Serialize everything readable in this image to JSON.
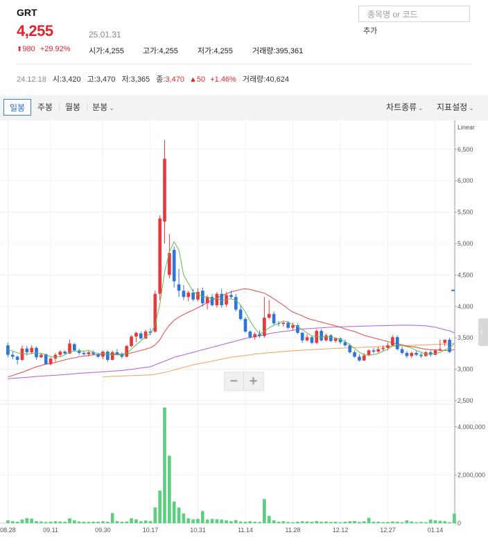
{
  "stock": {
    "name": "GRT",
    "price": "4,255",
    "date": "25.01.31",
    "change_amount": "980",
    "change_percent": "+29.92%",
    "open_label": "시가",
    "open": "4,255",
    "high_label": "고가",
    "high": "4,255",
    "low_label": "저가",
    "low": "4,255",
    "volume_label": "거래량",
    "volume": "395,361"
  },
  "search": {
    "placeholder": "종목명 or 코드",
    "add_label": "추가"
  },
  "hover": {
    "date": "24.12.18",
    "open_label": "시",
    "open": "3,420",
    "high_label": "고",
    "high": "3,470",
    "low_label": "저",
    "low": "3,365",
    "close_label": "종",
    "close": "3,470",
    "change": "50",
    "change_percent": "+1.46%",
    "volume_label": "거래량",
    "volume": "40,624"
  },
  "toolbar": {
    "tabs": [
      "일봉",
      "주봉",
      "월봉",
      "분봉"
    ],
    "active_tab": "일봉",
    "chart_type_label": "차트종류",
    "indicator_label": "지표설정"
  },
  "colors": {
    "up": "#e8383d",
    "down": "#2f74d8",
    "ma5": "#5cbf4e",
    "ma20": "#e04848",
    "ma60": "#b35ae0",
    "ma120": "#f0a05a",
    "volume": "#5ccf7e"
  },
  "chart_data": {
    "type": "candlestick",
    "scale_label": "Linear",
    "price_axis": {
      "ticks": [
        "6,500",
        "6,000",
        "5,500",
        "5,000",
        "4,500",
        "4,000",
        "3,500",
        "3,000",
        "2,500"
      ],
      "range": [
        2500,
        6850
      ]
    },
    "volume_axis": {
      "ticks": [
        "4,000,000",
        "2,000,000",
        "0"
      ],
      "range": [
        0,
        4800000
      ]
    },
    "x_labels": [
      "08.28",
      "09.11",
      "09.30",
      "10.17",
      "10.31",
      "11.14",
      "11.28",
      "12.12",
      "12.27",
      "01.14"
    ],
    "x_label_index": [
      0,
      9,
      20,
      30,
      40,
      50,
      60,
      70,
      80,
      90
    ],
    "last_price": 4255,
    "candles": [
      [
        3380,
        3420,
        3190,
        3230
      ],
      [
        3230,
        3280,
        3160,
        3200
      ],
      [
        3200,
        3220,
        3080,
        3150
      ],
      [
        3150,
        3380,
        3130,
        3330
      ],
      [
        3330,
        3370,
        3220,
        3270
      ],
      [
        3270,
        3380,
        3240,
        3340
      ],
      [
        3340,
        3360,
        3150,
        3190
      ],
      [
        3190,
        3260,
        3180,
        3230
      ],
      [
        3240,
        3250,
        3070,
        3080
      ],
      [
        3080,
        3190,
        3060,
        3170
      ],
      [
        3170,
        3260,
        3120,
        3230
      ],
      [
        3230,
        3300,
        3200,
        3280
      ],
      [
        3280,
        3300,
        3230,
        3250
      ],
      [
        3250,
        3470,
        3240,
        3410
      ],
      [
        3400,
        3420,
        3280,
        3300
      ],
      [
        3300,
        3330,
        3230,
        3260
      ],
      [
        3260,
        3290,
        3220,
        3240
      ],
      [
        3240,
        3290,
        3200,
        3270
      ],
      [
        3270,
        3300,
        3220,
        3240
      ],
      [
        3240,
        3260,
        3180,
        3200
      ],
      [
        3200,
        3300,
        3160,
        3280
      ],
      [
        3280,
        3300,
        3120,
        3150
      ],
      [
        3150,
        3300,
        3140,
        3270
      ],
      [
        3270,
        3320,
        3220,
        3240
      ],
      [
        3240,
        3270,
        3170,
        3200
      ],
      [
        3200,
        3390,
        3190,
        3370
      ],
      [
        3370,
        3540,
        3350,
        3520
      ],
      [
        3520,
        3600,
        3430,
        3580
      ],
      [
        3570,
        3600,
        3470,
        3490
      ],
      [
        3490,
        3630,
        3480,
        3600
      ],
      [
        3600,
        3650,
        3540,
        3580
      ],
      [
        3600,
        4250,
        3580,
        4200
      ],
      [
        4200,
        5450,
        4100,
        5400
      ],
      [
        5350,
        6650,
        5000,
        6350
      ],
      [
        4500,
        5150,
        4450,
        4850
      ],
      [
        4900,
        4950,
        4300,
        4400
      ],
      [
        4350,
        4600,
        4150,
        4250
      ],
      [
        4250,
        4340,
        4100,
        4150
      ],
      [
        4150,
        4250,
        4080,
        4220
      ],
      [
        4220,
        4280,
        4080,
        4110
      ],
      [
        4110,
        4290,
        4080,
        4230
      ],
      [
        4250,
        4300,
        4000,
        4050
      ],
      [
        4050,
        4180,
        3950,
        4150
      ],
      [
        4150,
        4200,
        4000,
        4020
      ],
      [
        4020,
        4230,
        3980,
        4200
      ],
      [
        4200,
        4280,
        3980,
        4020
      ],
      [
        4030,
        4230,
        3990,
        4180
      ],
      [
        4180,
        4250,
        4120,
        4150
      ],
      [
        4150,
        4200,
        3920,
        3950
      ],
      [
        3950,
        4020,
        3780,
        3800
      ],
      [
        3800,
        3830,
        3580,
        3600
      ],
      [
        3600,
        3620,
        3490,
        3510
      ],
      [
        3510,
        3590,
        3470,
        3560
      ],
      [
        3560,
        3620,
        3500,
        3530
      ],
      [
        3530,
        4150,
        3500,
        3820
      ],
      [
        3820,
        4100,
        3800,
        3880
      ],
      [
        3880,
        3920,
        3700,
        3730
      ],
      [
        3730,
        3770,
        3680,
        3720
      ],
      [
        3720,
        3760,
        3680,
        3740
      ],
      [
        3740,
        3770,
        3640,
        3660
      ],
      [
        3660,
        3740,
        3620,
        3700
      ],
      [
        3700,
        3730,
        3560,
        3580
      ],
      [
        3580,
        3600,
        3420,
        3460
      ],
      [
        3460,
        3560,
        3440,
        3510
      ],
      [
        3510,
        3530,
        3400,
        3420
      ],
      [
        3420,
        3640,
        3400,
        3610
      ],
      [
        3610,
        3640,
        3440,
        3460
      ],
      [
        3460,
        3570,
        3440,
        3540
      ],
      [
        3540,
        3560,
        3430,
        3450
      ],
      [
        3450,
        3510,
        3420,
        3490
      ],
      [
        3490,
        3510,
        3400,
        3430
      ],
      [
        3430,
        3470,
        3360,
        3380
      ],
      [
        3380,
        3410,
        3250,
        3270
      ],
      [
        3270,
        3300,
        3180,
        3200
      ],
      [
        3200,
        3240,
        3120,
        3140
      ],
      [
        3140,
        3260,
        3130,
        3220
      ],
      [
        3220,
        3320,
        3210,
        3300
      ],
      [
        3300,
        3340,
        3250,
        3280
      ],
      [
        3280,
        3360,
        3260,
        3320
      ],
      [
        3320,
        3380,
        3280,
        3340
      ],
      [
        3340,
        3420,
        3300,
        3380
      ],
      [
        3380,
        3540,
        3360,
        3510
      ],
      [
        3510,
        3540,
        3300,
        3320
      ],
      [
        3320,
        3360,
        3230,
        3260
      ],
      [
        3260,
        3290,
        3180,
        3210
      ],
      [
        3210,
        3280,
        3180,
        3260
      ],
      [
        3260,
        3290,
        3210,
        3230
      ],
      [
        3230,
        3260,
        3180,
        3210
      ],
      [
        3210,
        3290,
        3200,
        3270
      ],
      [
        3270,
        3300,
        3200,
        3230
      ],
      [
        3230,
        3320,
        3220,
        3300
      ],
      [
        3300,
        3470,
        3290,
        3320
      ],
      [
        3420,
        3470,
        3365,
        3470
      ],
      [
        3470,
        3500,
        3260,
        3275
      ]
    ],
    "ma5": [
      3310,
      3290,
      3260,
      3250,
      3240,
      3250,
      3260,
      3250,
      3230,
      3200,
      3190,
      3200,
      3230,
      3270,
      3290,
      3290,
      3290,
      3300,
      3270,
      3250,
      3250,
      3240,
      3230,
      3230,
      3230,
      3250,
      3320,
      3390,
      3450,
      3520,
      3570,
      3700,
      4040,
      4550,
      4870,
      5030,
      4900,
      4500,
      4370,
      4230,
      4190,
      4160,
      4150,
      4120,
      4130,
      4090,
      4110,
      4120,
      4100,
      4020,
      3910,
      3770,
      3650,
      3560,
      3600,
      3660,
      3700,
      3730,
      3770,
      3750,
      3710,
      3680,
      3630,
      3580,
      3530,
      3520,
      3510,
      3520,
      3510,
      3500,
      3470,
      3440,
      3390,
      3330,
      3270,
      3230,
      3230,
      3230,
      3250,
      3290,
      3320,
      3370,
      3390,
      3380,
      3360,
      3340,
      3300,
      3270,
      3240,
      3240,
      3250,
      3270,
      3310,
      3340,
      3410
    ],
    "ma20": [
      2880,
      2900,
      2930,
      2950,
      2980,
      3010,
      3040,
      3060,
      3080,
      3090,
      3110,
      3130,
      3150,
      3170,
      3180,
      3200,
      3210,
      3220,
      3230,
      3230,
      3240,
      3240,
      3240,
      3240,
      3240,
      3250,
      3260,
      3280,
      3300,
      3320,
      3340,
      3390,
      3470,
      3600,
      3700,
      3780,
      3830,
      3870,
      3910,
      3940,
      3980,
      4020,
      4060,
      4100,
      4140,
      4170,
      4200,
      4230,
      4250,
      4270,
      4280,
      4270,
      4250,
      4230,
      4210,
      4170,
      4120,
      4070,
      4020,
      3960,
      3910,
      3880,
      3850,
      3810,
      3790,
      3770,
      3750,
      3730,
      3710,
      3690,
      3670,
      3640,
      3620,
      3600,
      3570,
      3540,
      3520,
      3500,
      3480,
      3460,
      3440,
      3420,
      3400,
      3390,
      3370,
      3360,
      3350,
      3330,
      3320,
      3310,
      3310,
      3300,
      3300,
      3300,
      3310
    ],
    "ma60": [
      2850,
      2855,
      2860,
      2865,
      2870,
      2880,
      2885,
      2890,
      2895,
      2900,
      2905,
      2910,
      2915,
      2920,
      2930,
      2935,
      2940,
      2945,
      2950,
      2955,
      2960,
      2965,
      2970,
      2975,
      2980,
      2990,
      3000,
      3010,
      3020,
      3030,
      3040,
      3070,
      3100,
      3130,
      3160,
      3190,
      3210,
      3230,
      3250,
      3270,
      3290,
      3310,
      3330,
      3350,
      3370,
      3390,
      3410,
      3430,
      3450,
      3470,
      3490,
      3505,
      3520,
      3535,
      3550,
      3565,
      3580,
      3590,
      3600,
      3610,
      3620,
      3630,
      3640,
      3645,
      3650,
      3655,
      3660,
      3665,
      3670,
      3672,
      3675,
      3678,
      3680,
      3682,
      3684,
      3686,
      3688,
      3690,
      3692,
      3694,
      3696,
      3698,
      3700,
      3700,
      3700,
      3700,
      3698,
      3695,
      3690,
      3680,
      3670,
      3650,
      3630,
      3610,
      3580
    ],
    "ma120": [
      null,
      null,
      null,
      null,
      null,
      null,
      null,
      null,
      null,
      null,
      null,
      null,
      null,
      null,
      null,
      null,
      null,
      null,
      null,
      null,
      2880,
      2883,
      2886,
      2889,
      2892,
      2895,
      2898,
      2901,
      2904,
      2907,
      2910,
      2920,
      2935,
      2950,
      2970,
      2990,
      3010,
      3030,
      3050,
      3070,
      3085,
      3100,
      3115,
      3130,
      3145,
      3160,
      3175,
      3190,
      3200,
      3210,
      3220,
      3230,
      3240,
      3248,
      3255,
      3262,
      3269,
      3276,
      3282,
      3288,
      3293,
      3298,
      3303,
      3308,
      3312,
      3316,
      3320,
      3324,
      3328,
      3332,
      3335,
      3338,
      3341,
      3344,
      3347,
      3350,
      3353,
      3356,
      3359,
      3362,
      3365,
      3368,
      3371,
      3374,
      3377,
      3380,
      3383,
      3386,
      3389,
      3392,
      3395,
      3398,
      3401,
      3404,
      3408
    ],
    "volume": [
      120000,
      80000,
      60000,
      150000,
      210000,
      190000,
      90000,
      70000,
      50000,
      60000,
      80000,
      70000,
      60000,
      200000,
      120000,
      70000,
      60000,
      50000,
      60000,
      60000,
      80000,
      60000,
      420000,
      90000,
      60000,
      70000,
      200000,
      160000,
      80000,
      110000,
      90000,
      650000,
      1350000,
      4800000,
      2800000,
      900000,
      650000,
      400000,
      200000,
      160000,
      180000,
      500000,
      150000,
      180000,
      160000,
      150000,
      120000,
      80000,
      130000,
      70000,
      60000,
      80000,
      60000,
      50000,
      1000000,
      300000,
      120000,
      60000,
      80000,
      50000,
      40000,
      60000,
      80000,
      70000,
      60000,
      90000,
      60000,
      70000,
      50000,
      60000,
      40000,
      60000,
      80000,
      90000,
      50000,
      80000,
      220000,
      60000,
      60000,
      40000,
      50000,
      70000,
      60000,
      40000,
      120000,
      70000,
      40000,
      50000,
      40000,
      150000,
      120000,
      100000,
      80000,
      40624,
      395361
    ]
  }
}
